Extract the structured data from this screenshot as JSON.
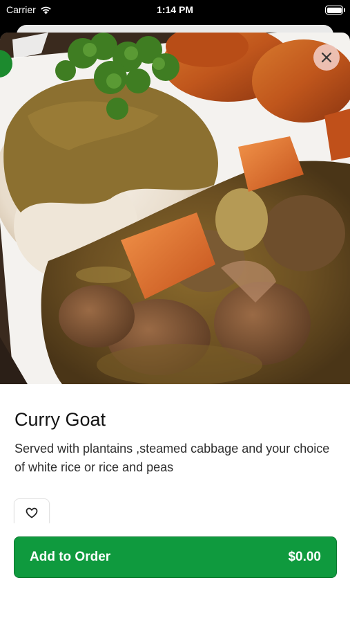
{
  "status_bar": {
    "carrier": "Carrier",
    "time": "1:14 PM",
    "icons": [
      "wifi-icon",
      "battery-icon"
    ]
  },
  "item": {
    "name": "Curry Goat",
    "description": "Served with plantains ,steamed cabbage and your choice of white rice or rice and peas",
    "image_alt": "Curry goat with white rice, carrots and plantains"
  },
  "actions": {
    "close_icon": "close-icon",
    "favorite_icon": "heart-outline-icon",
    "add_to_order_label": "Add to Order",
    "price": "$0.00"
  },
  "colors": {
    "accent": "#0f9a3e",
    "close_bg": "#f0c8be"
  }
}
